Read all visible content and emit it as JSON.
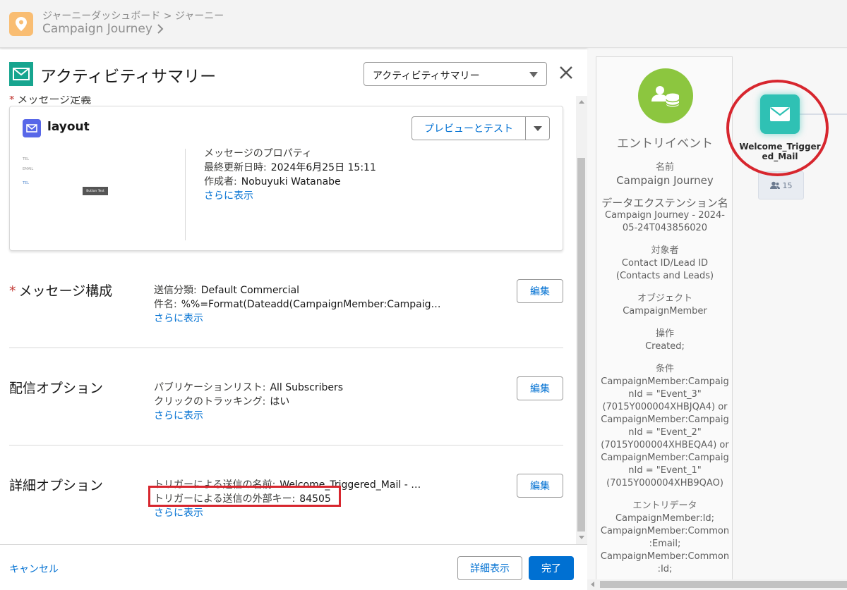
{
  "header": {
    "breadcrumb_parent": "ジャーニーダッシュボード",
    "breadcrumb_sep": ">",
    "breadcrumb_current": "ジャーニー",
    "title": "Campaign Journey",
    "app_icon": "map-pin-icon",
    "app_icon_color": "#f9bd72"
  },
  "modal": {
    "title": "アクティビティサマリー",
    "select_value": "アクティビティサマリー",
    "message_def_label": "メッセージ定義",
    "card": {
      "title": "layout",
      "preview_button": "プレビューとテスト",
      "thumb": {
        "line1": "TEL",
        "line2": "EMAIL",
        "line3": "TEL",
        "button": "Button Text"
      },
      "props_heading": "メッセージのプロパティ",
      "updated_label": "最終更新日時:",
      "updated_value": "2024年6月25日 15:11",
      "author_label": "作成者:",
      "author_value": "Nobuyuki Watanabe",
      "more": "さらに表示"
    },
    "sections": [
      {
        "title": "メッセージ構成",
        "required": true,
        "lines": [
          {
            "label": "送信分類:",
            "value": "Default Commercial"
          },
          {
            "label": "件名:",
            "value": "%%=Format(Dateadd(CampaignMember:Campaig…"
          }
        ],
        "more": "さらに表示",
        "edit": "編集"
      },
      {
        "title": "配信オプション",
        "required": false,
        "lines": [
          {
            "label": "パブリケーションリスト:",
            "value": "All Subscribers"
          },
          {
            "label": "クリックのトラッキング:",
            "value": "はい"
          }
        ],
        "more": "さらに表示",
        "edit": "編集"
      },
      {
        "title": "詳細オプション",
        "required": false,
        "lines": [
          {
            "label": "トリガーによる送信の名前:",
            "value": "Welcome_Triggered_Mail - …"
          },
          {
            "label": "トリガーによる送信の外部キー:",
            "value": "84505"
          }
        ],
        "more": "さらに表示",
        "edit": "編集"
      }
    ],
    "footer": {
      "cancel": "キャンセル",
      "detail": "詳細表示",
      "done": "完了"
    }
  },
  "entry_panel": {
    "title": "エントリイベント",
    "name_label": "名前",
    "name_value": "Campaign Journey",
    "de_label": "データエクステンション名",
    "de_value_1": "Campaign Journey - 2024-",
    "de_value_2": "05-24T043856020",
    "target_label": "対象者",
    "target_value_1": "Contact ID/Lead ID",
    "target_value_2": "(Contacts and Leads)",
    "object_label": "オブジェクト",
    "object_value": "CampaignMember",
    "op_label": "操作",
    "op_value": "Created;",
    "cond_label": "条件",
    "cond_lines": [
      "CampaignMember:Campaig",
      "nId = \"Event_3\"",
      "(7015Y000004XHBJQA4) or",
      "CampaignMember:Campaig",
      "nId = \"Event_2\"",
      "(7015Y000004XHBEQA4) or",
      "CampaignMember:Campaig",
      "nId = \"Event_1\"",
      "(7015Y000004XHB9QAO)"
    ],
    "entry_label": "エントリデータ",
    "entry_lines": [
      "CampaignMember:Id;",
      "CampaignMember:Common",
      ":Email;",
      "CampaignMember:Common",
      ":Id;"
    ]
  },
  "canvas": {
    "node_label_1": "Welcome_Trigger",
    "node_label_2": "ed_Mail",
    "count": "15",
    "node_color": "#2fc1b4",
    "highlight_color": "#d7262e"
  }
}
